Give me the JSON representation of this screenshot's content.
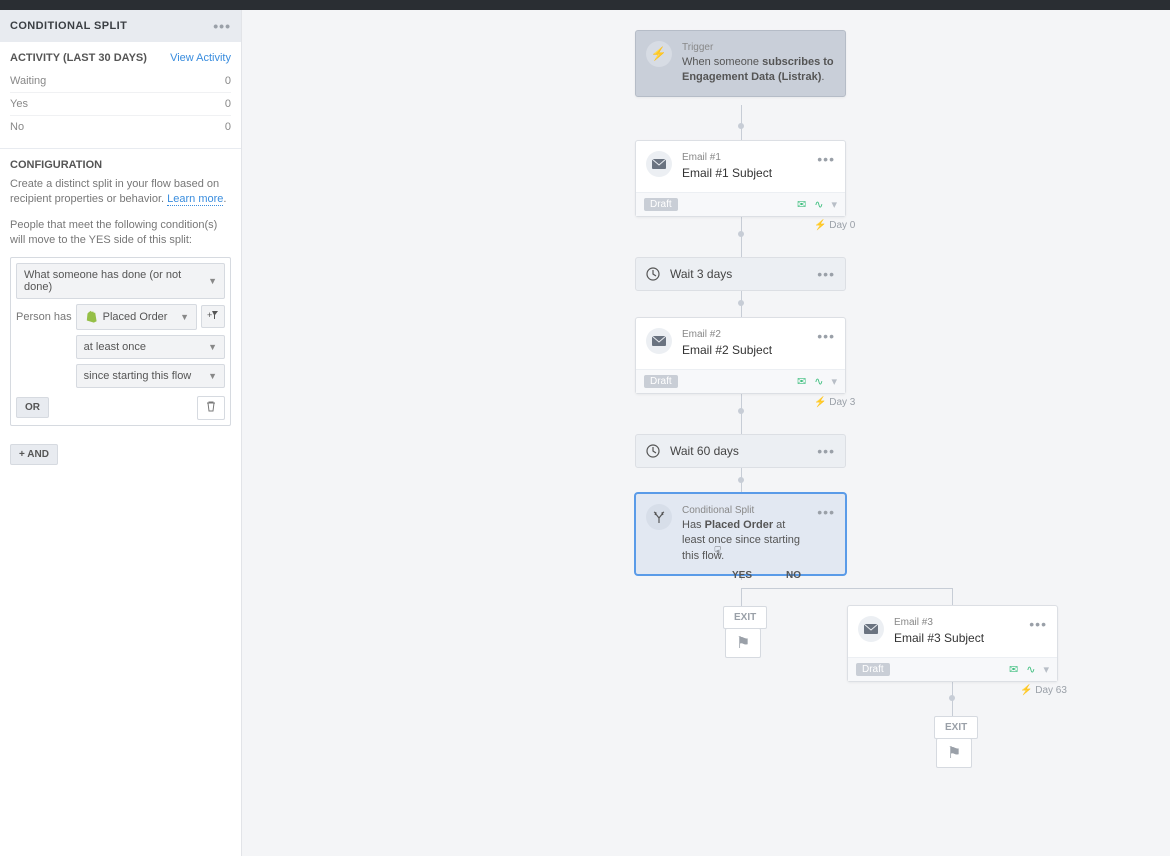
{
  "sidebar": {
    "header": "CONDITIONAL SPLIT",
    "activityHeader": "ACTIVITY (LAST 30 DAYS)",
    "viewActivity": "View Activity",
    "rows": [
      {
        "label": "Waiting",
        "value": "0"
      },
      {
        "label": "Yes",
        "value": "0"
      },
      {
        "label": "No",
        "value": "0"
      }
    ],
    "configHeader": "CONFIGURATION",
    "configDesc": "Create a distinct split in your flow based on recipient properties or behavior. ",
    "learnMore": "Learn more",
    "configDesc2": "People that meet the following condition(s) will move to the YES side of this split:",
    "select1": "What someone has done (or not done)",
    "personHas": "Person has",
    "placedOrder": "Placed Order",
    "filterIcon": "+▾",
    "atLeastOnce": "at least once",
    "sinceStarting": "since starting this flow",
    "orLabel": "OR",
    "andLabel": "+ AND"
  },
  "nodes": {
    "trigger": {
      "label": "Trigger",
      "text1": "When someone ",
      "bold1": "subscribes to Engagement Data (Listrak)",
      "tail": "."
    },
    "email1": {
      "label": "Email #1",
      "subject": "Email #1 Subject"
    },
    "wait1": "Wait 3 days",
    "email2": {
      "label": "Email #2",
      "subject": "Email #2 Subject"
    },
    "wait2": "Wait 60 days",
    "split": {
      "label": "Conditional Split",
      "text1": "Has ",
      "bold1": "Placed Order",
      "text2": " at least once since starting this flow."
    },
    "email3": {
      "label": "Email #3",
      "subject": "Email #3 Subject"
    },
    "draft": "Draft",
    "day0": "⚡ Day 0",
    "day3": "⚡ Day 3",
    "day63": "⚡ Day 63",
    "yes": "YES",
    "no": "NO",
    "exit": "EXIT"
  }
}
